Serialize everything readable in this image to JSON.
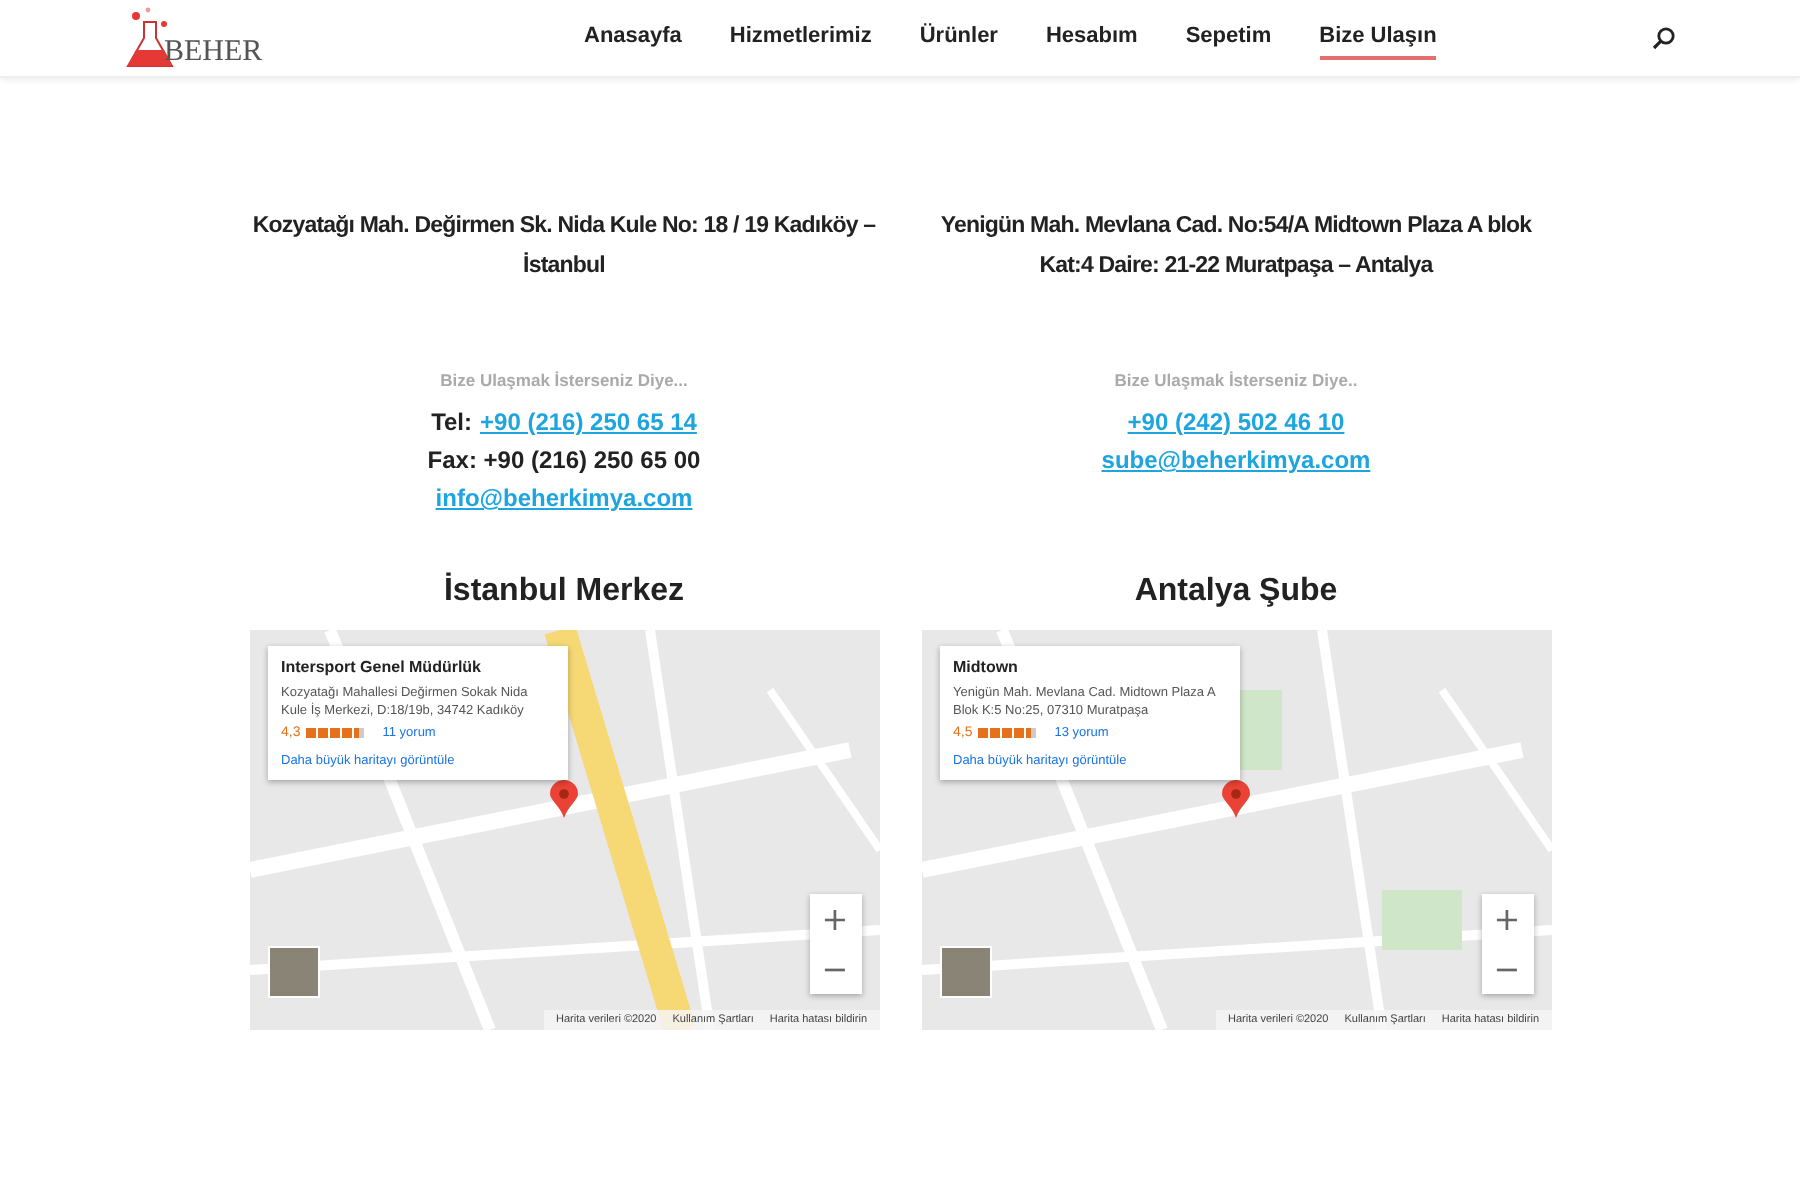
{
  "header": {
    "logo_text": "BEHER",
    "nav": [
      {
        "label": "Anasayfa",
        "selected": false
      },
      {
        "label": "Hizmetlerimiz",
        "selected": false
      },
      {
        "label": "Ürünler",
        "selected": false
      },
      {
        "label": "Hesabım",
        "selected": false
      },
      {
        "label": "Sepetim",
        "selected": false
      },
      {
        "label": "Bize Ulaşın",
        "selected": true
      }
    ]
  },
  "locations": [
    {
      "address": "Kozyatağı Mah. Değirmen Sk. Nida Kule No: 18 / 19 Kadıköy – İstanbul",
      "contact_intro": "Bize Ulaşmak İsterseniz Diye...",
      "contact_lines": [
        {
          "kind": "labeled_link",
          "label": "Tel:",
          "link": "+90 (216) 250 65 14"
        },
        {
          "kind": "text",
          "text": "Fax: +90 (216) 250 65 00"
        },
        {
          "kind": "link",
          "link": "info@beherkimya.com"
        }
      ],
      "heading": "İstanbul Merkez",
      "map": {
        "place": "Intersport Genel Müdürlük",
        "address": "Kozyatağı Mahallesi Değirmen Sokak Nida Kule İş Merkezi, D:18/19b, 34742 Kadıköy",
        "rating": "4,3",
        "stars": 4.5,
        "reviews": "11 yorum",
        "larger_map": "Daha büyük haritayı görüntüle",
        "zoom": [
          "+",
          "−"
        ],
        "attribution": [
          "Harita verileri ©2020",
          "Kullanım Şartları",
          "Harita hatası bildirin"
        ]
      }
    },
    {
      "address": "Yenigün Mah. Mevlana Cad. No:54/A Midtown Plaza A blok Kat:4 Daire: 21-22 Muratpaşa – Antalya",
      "contact_intro": "Bize Ulaşmak İsterseniz Diye..",
      "contact_lines": [
        {
          "kind": "link",
          "link": "+90 (242) 502 46 10"
        },
        {
          "kind": "link",
          "link": "sube@beherkimya.com"
        }
      ],
      "heading": "Antalya Şube",
      "map": {
        "place": "Midtown",
        "address": "Yenigün Mah. Mevlana Cad. Midtown Plaza A Blok K:5 No:25, 07310 Muratpaşa",
        "rating": "4,5",
        "stars": 4.5,
        "reviews": "13 yorum",
        "larger_map": "Daha büyük haritayı görüntüle",
        "zoom": [
          "+",
          "−"
        ],
        "attribution": [
          "Harita verileri ©2020",
          "Kullanım Şartları",
          "Harita hatası bildirin"
        ]
      }
    }
  ]
}
